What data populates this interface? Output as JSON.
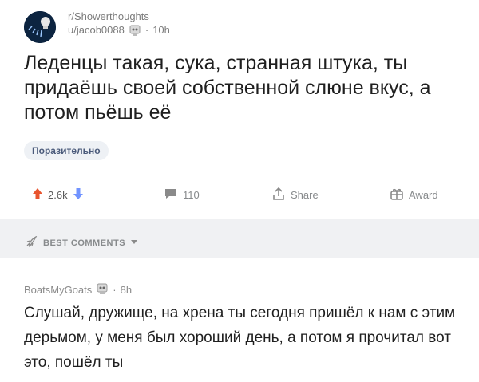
{
  "post": {
    "subreddit": "r/Showerthoughts",
    "author": "u/jacob0088",
    "age": "10h",
    "title": "Леденцы такая, сука, странная штука, ты придаёшь своей собственной слюне вкус, а потом пьёшь её",
    "flair": "Поразительно"
  },
  "actions": {
    "score": "2.6k",
    "comments": "110",
    "share": "Share",
    "award": "Award"
  },
  "sort": {
    "label": "BEST COMMENTS"
  },
  "comment": {
    "author": "BoatsMyGoats",
    "age": "8h",
    "body": "Слушай, дружище, на хрена ты сегодня пришёл к нам с этим дерьмом, у меня был хороший день, а потом я прочитал вот это, пошёл ты"
  },
  "colors": {
    "upvote": "#e8542e",
    "downvote": "#7193ff",
    "avatar_bg": "#0c2440"
  },
  "icons": [
    "subreddit-avatar-icon",
    "award-badge-icon",
    "upvote-icon",
    "downvote-icon",
    "comment-icon",
    "share-icon",
    "gift-icon",
    "rocket-icon",
    "chevron-down-icon"
  ]
}
